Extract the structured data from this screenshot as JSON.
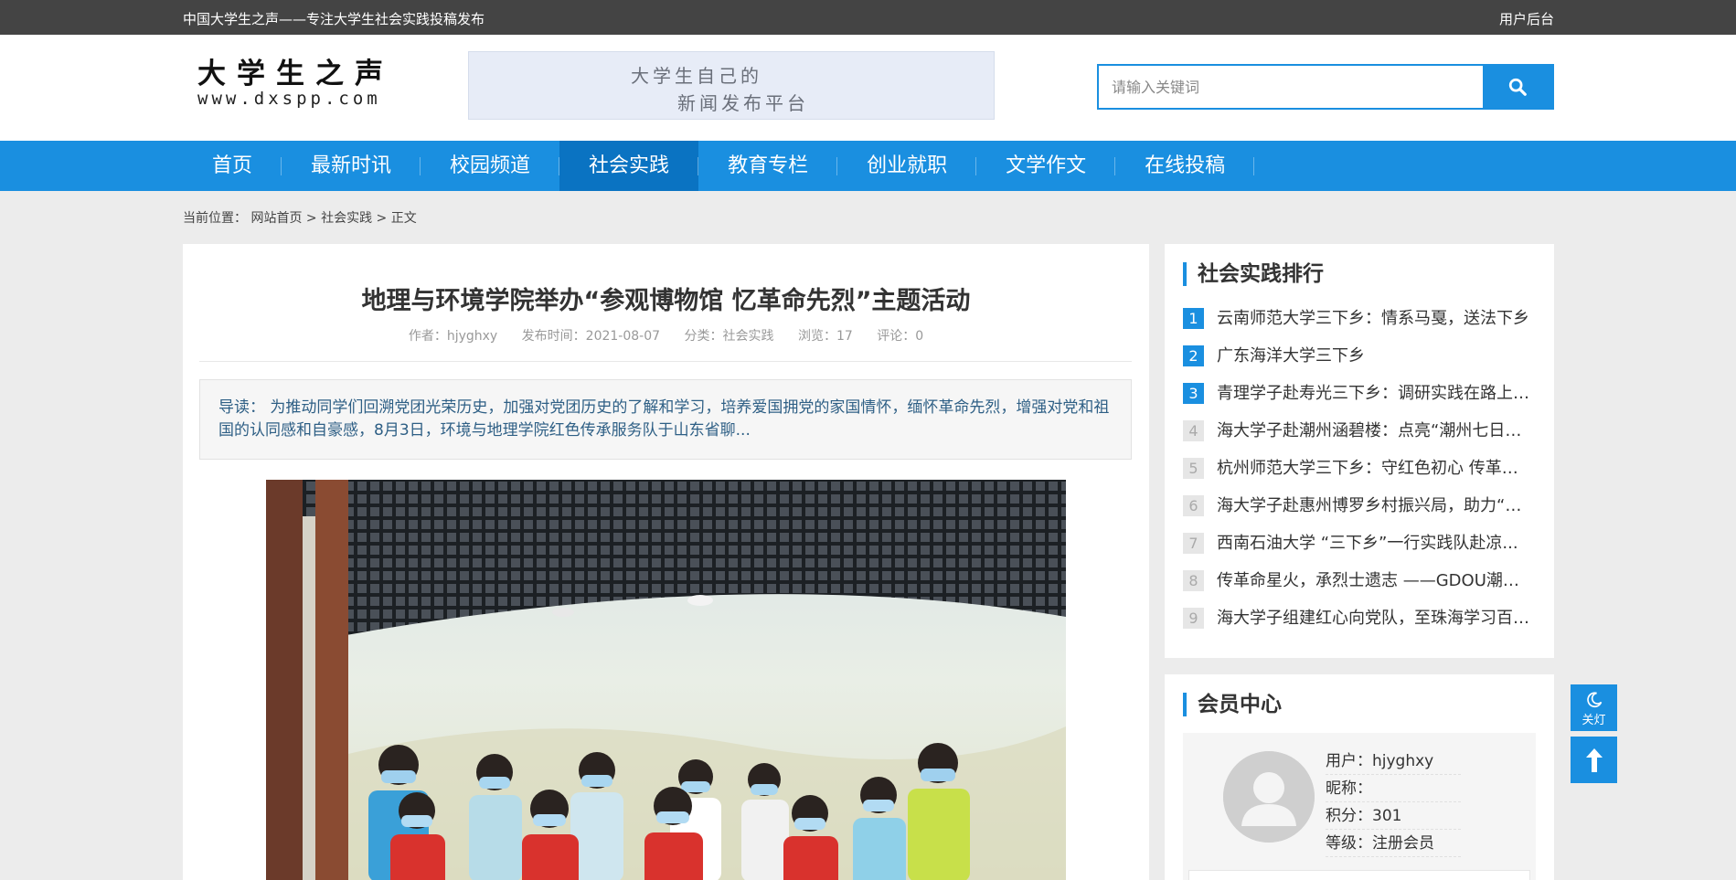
{
  "topbar": {
    "slogan": "中国大学生之声——专注大学生社会实践投稿发布",
    "admin_link": "用户后台"
  },
  "header": {
    "logo_cn": "大学生之声",
    "logo_en": "www.dxspp.com",
    "banner_line1": "大学生自己的",
    "banner_line2": "新闻发布平台",
    "search_placeholder": "请输入关键词",
    "search_icon": "search-icon"
  },
  "nav": {
    "items": [
      {
        "label": "首页"
      },
      {
        "label": "最新时讯"
      },
      {
        "label": "校园频道"
      },
      {
        "label": "社会实践"
      },
      {
        "label": "教育专栏"
      },
      {
        "label": "创业就职"
      },
      {
        "label": "文学作文"
      },
      {
        "label": "在线投稿"
      }
    ],
    "active_index": 3
  },
  "breadcrumb": {
    "prefix": "当前位置：",
    "home": "网站首页",
    "sep": ">",
    "category": "社会实践",
    "current": "正文"
  },
  "article": {
    "title": "地理与环境学院举办“参观博物馆 忆革命先烈”主题活动",
    "author": "作者：hjyghxy",
    "date": "发布时间：2021-08-07",
    "category": "分类：社会实践",
    "views": "浏览：17",
    "comments": "评论：0",
    "lead": "导读： 为推动同学们回溯党团光荣历史，加强对党团历史的了解和学习，培养爱国拥党的家国情怀，缅怀革命先烈，增强对党和祖国的认同感和自豪感，8月3日，环境与地理学院红色传承服务队于山东省聊..."
  },
  "ranking": {
    "title": "社会实践排行",
    "items": [
      {
        "num": "1",
        "title": "云南师范大学三下乡：情系马戛，送法下乡"
      },
      {
        "num": "2",
        "title": "广东海洋大学三下乡"
      },
      {
        "num": "3",
        "title": "青理学子赴寿光三下乡：调研实践在路上，..."
      },
      {
        "num": "4",
        "title": "海大学子赴潮州涵碧楼：点亮“潮州七日红..."
      },
      {
        "num": "5",
        "title": "杭州师范大学三下乡：守红色初心 传革命..."
      },
      {
        "num": "6",
        "title": "海大学子赴惠州博罗乡村振兴局，助力“鹅..."
      },
      {
        "num": "7",
        "title": "西南石油大学 “三下乡”一行实践队赴凉..."
      },
      {
        "num": "8",
        "title": "传革命星火，承烈士遗志 ——GDOU潮州..."
      },
      {
        "num": "9",
        "title": "海大学子组建红心向党队，至珠海学习百年..."
      }
    ]
  },
  "member": {
    "title": "会员中心",
    "user": "用户：hjyghxy",
    "nickname": "昵称：",
    "points": "积分：301",
    "level": "等级：注册会员"
  },
  "float": {
    "dark_label": "关灯",
    "dark_icon": "moon-icon",
    "top_icon": "arrow-up-icon"
  },
  "colors": {
    "accent": "#1a8fe0",
    "nav_active": "#0a73c2",
    "topbar": "#444444"
  }
}
